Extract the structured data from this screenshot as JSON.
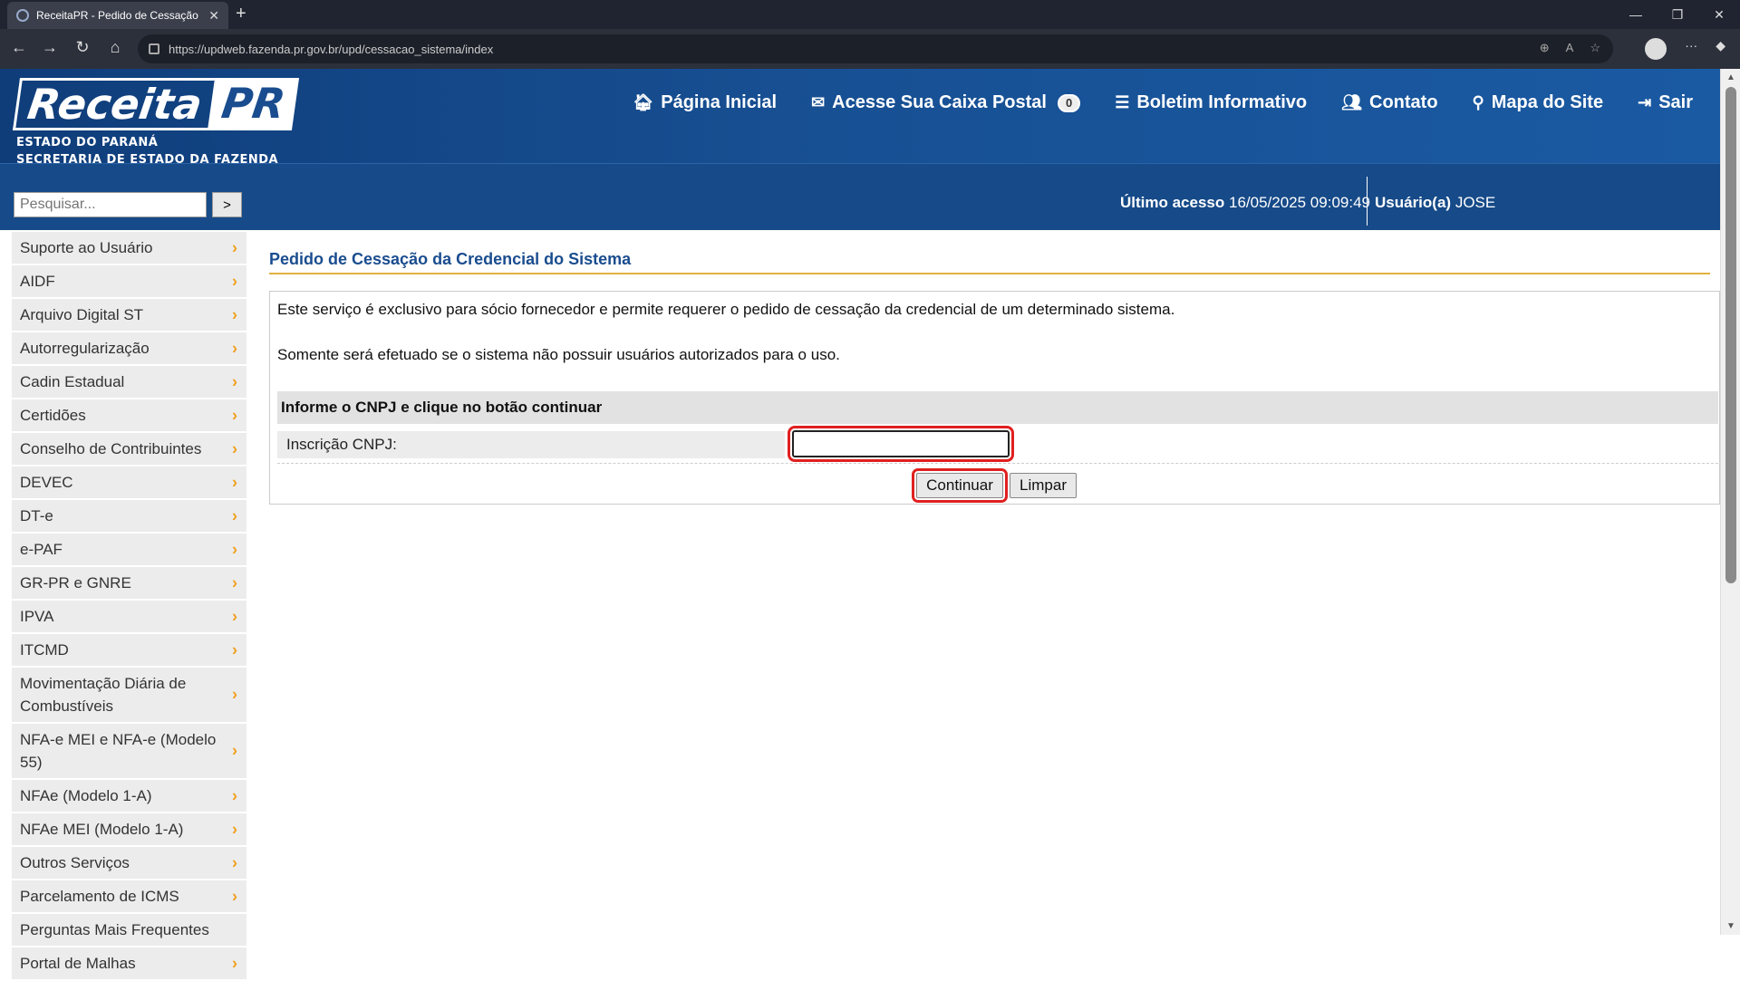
{
  "browser": {
    "tab_title": "ReceitaPR - Pedido de Cessação d",
    "url": "https://updweb.fazenda.pr.gov.br/upd/cessacao_sistema/index"
  },
  "header": {
    "logo_word": "Receita",
    "logo_pr": "PR",
    "logo_line1": "ESTADO DO PARANÁ",
    "logo_line2": "SECRETARIA DE ESTADO DA FAZENDA",
    "nav": {
      "home": "Página Inicial",
      "mailbox": "Acesse Sua Caixa Postal",
      "mailbox_count": "0",
      "bulletin": "Boletim Informativo",
      "contact": "Contato",
      "sitemap": "Mapa do Site",
      "logout": "Sair"
    }
  },
  "subbar": {
    "search_placeholder": "Pesquisar...",
    "search_button": ">",
    "last_access_label": "Último acesso",
    "last_access_value": "16/05/2025 09:09:49",
    "user_label": "Usuário(a)",
    "user_value": "JOSE"
  },
  "sidebar": {
    "items": [
      {
        "label": "Suporte ao Usuário",
        "has_submenu": true
      },
      {
        "label": "AIDF",
        "has_submenu": true
      },
      {
        "label": "Arquivo Digital ST",
        "has_submenu": true
      },
      {
        "label": "Autorregularização",
        "has_submenu": true
      },
      {
        "label": "Cadin Estadual",
        "has_submenu": true
      },
      {
        "label": "Certidões",
        "has_submenu": true
      },
      {
        "label": "Conselho de Contribuintes",
        "has_submenu": true
      },
      {
        "label": "DEVEC",
        "has_submenu": true
      },
      {
        "label": "DT-e",
        "has_submenu": true
      },
      {
        "label": "e-PAF",
        "has_submenu": true
      },
      {
        "label": "GR-PR e GNRE",
        "has_submenu": true
      },
      {
        "label": "IPVA",
        "has_submenu": true
      },
      {
        "label": "ITCMD",
        "has_submenu": true
      },
      {
        "label": "Movimentação Diária de Combustíveis",
        "has_submenu": true
      },
      {
        "label": "NFA-e MEI e NFA-e (Modelo 55)",
        "has_submenu": true
      },
      {
        "label": "NFAe (Modelo 1-A)",
        "has_submenu": true
      },
      {
        "label": "NFAe MEI (Modelo 1-A)",
        "has_submenu": true
      },
      {
        "label": "Outros Serviços",
        "has_submenu": true
      },
      {
        "label": "Parcelamento de ICMS",
        "has_submenu": true
      },
      {
        "label": "Perguntas Mais Frequentes",
        "has_submenu": false
      },
      {
        "label": "Portal de Malhas",
        "has_submenu": true
      }
    ]
  },
  "main": {
    "title": "Pedido de Cessação da Credencial do Sistema",
    "description1": "Este serviço é exclusivo para sócio fornecedor e permite requerer o pedido de cessação da credencial de um determinado sistema.",
    "description2": "Somente será efetuado se o sistema não possuir usuários autorizados para o uso.",
    "form_heading": "Informe o CNPJ e clique no botão continuar",
    "cnpj_label": "Inscrição CNPJ:",
    "cnpj_value": "",
    "continue_button": "Continuar",
    "clear_button": "Limpar"
  },
  "colors": {
    "header_blue": "#164a88",
    "title_blue": "#1a4d8f",
    "chevron_orange": "#f0a020",
    "highlight_red": "#e02020"
  }
}
